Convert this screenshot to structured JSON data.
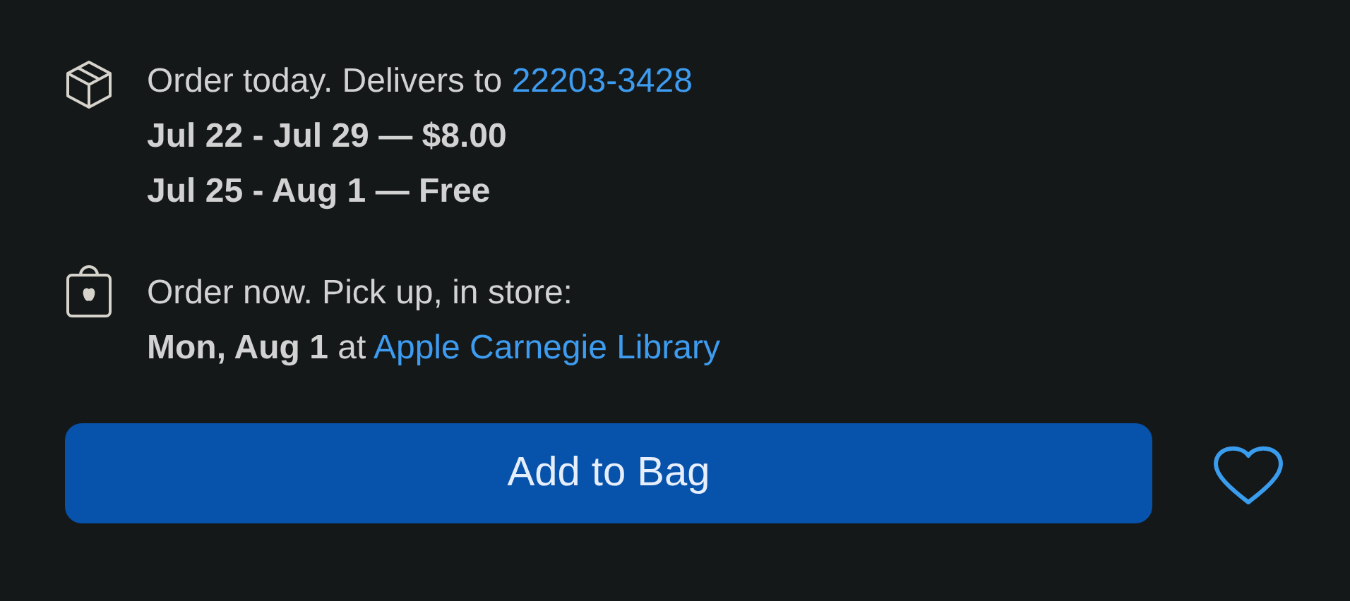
{
  "delivery": {
    "text": "Order today. Delivers to ",
    "zip_link": "22203-3428",
    "options": [
      "Jul 22 - Jul 29 — $8.00",
      "Jul 25 - Aug 1 — Free"
    ]
  },
  "pickup": {
    "text": "Order now. Pick up, in store:",
    "date_text": "**Mon, Aug 1** at ",
    "store_link": "Apple Carnegie Library"
  },
  "add_button": "Add to Bag"
}
